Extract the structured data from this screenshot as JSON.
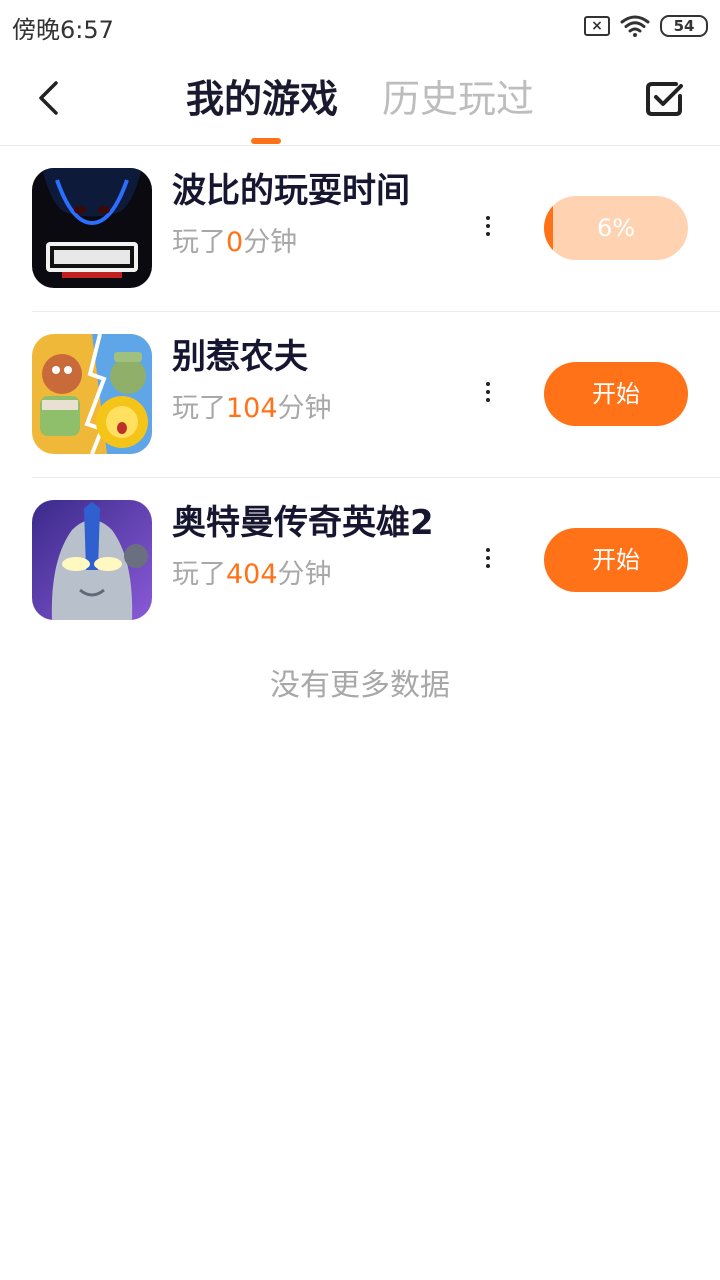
{
  "status_bar": {
    "time": "傍晚6:57",
    "battery": "54",
    "icons": [
      "sim-off-icon",
      "wifi-icon",
      "battery-icon"
    ]
  },
  "header": {
    "tabs": [
      {
        "label": "我的游戏",
        "active": true
      },
      {
        "label": "历史玩过",
        "active": false
      }
    ],
    "back_icon": "chevron-left-icon",
    "select_icon": "checkbox-icon"
  },
  "games": [
    {
      "title": "波比的玩耍时间",
      "played_prefix": "玩了",
      "played_minutes": "0",
      "played_suffix": "分钟",
      "action": {
        "type": "progress",
        "label": "6%",
        "progress": 0.06
      },
      "icon": "poppy-playtime-icon"
    },
    {
      "title": "别惹农夫",
      "played_prefix": "玩了",
      "played_minutes": "104",
      "played_suffix": "分钟",
      "action": {
        "type": "start",
        "label": "开始"
      },
      "icon": "farmer-game-icon"
    },
    {
      "title": "奥特曼传奇英雄2",
      "played_prefix": "玩了",
      "played_minutes": "404",
      "played_suffix": "分钟",
      "action": {
        "type": "start",
        "label": "开始"
      },
      "icon": "ultraman-icon"
    }
  ],
  "footer_text": "没有更多数据",
  "colors": {
    "accent": "#ff7217",
    "progress_track": "#ffd3b2",
    "title_text": "#161630",
    "muted_text": "#a8a8a8"
  }
}
